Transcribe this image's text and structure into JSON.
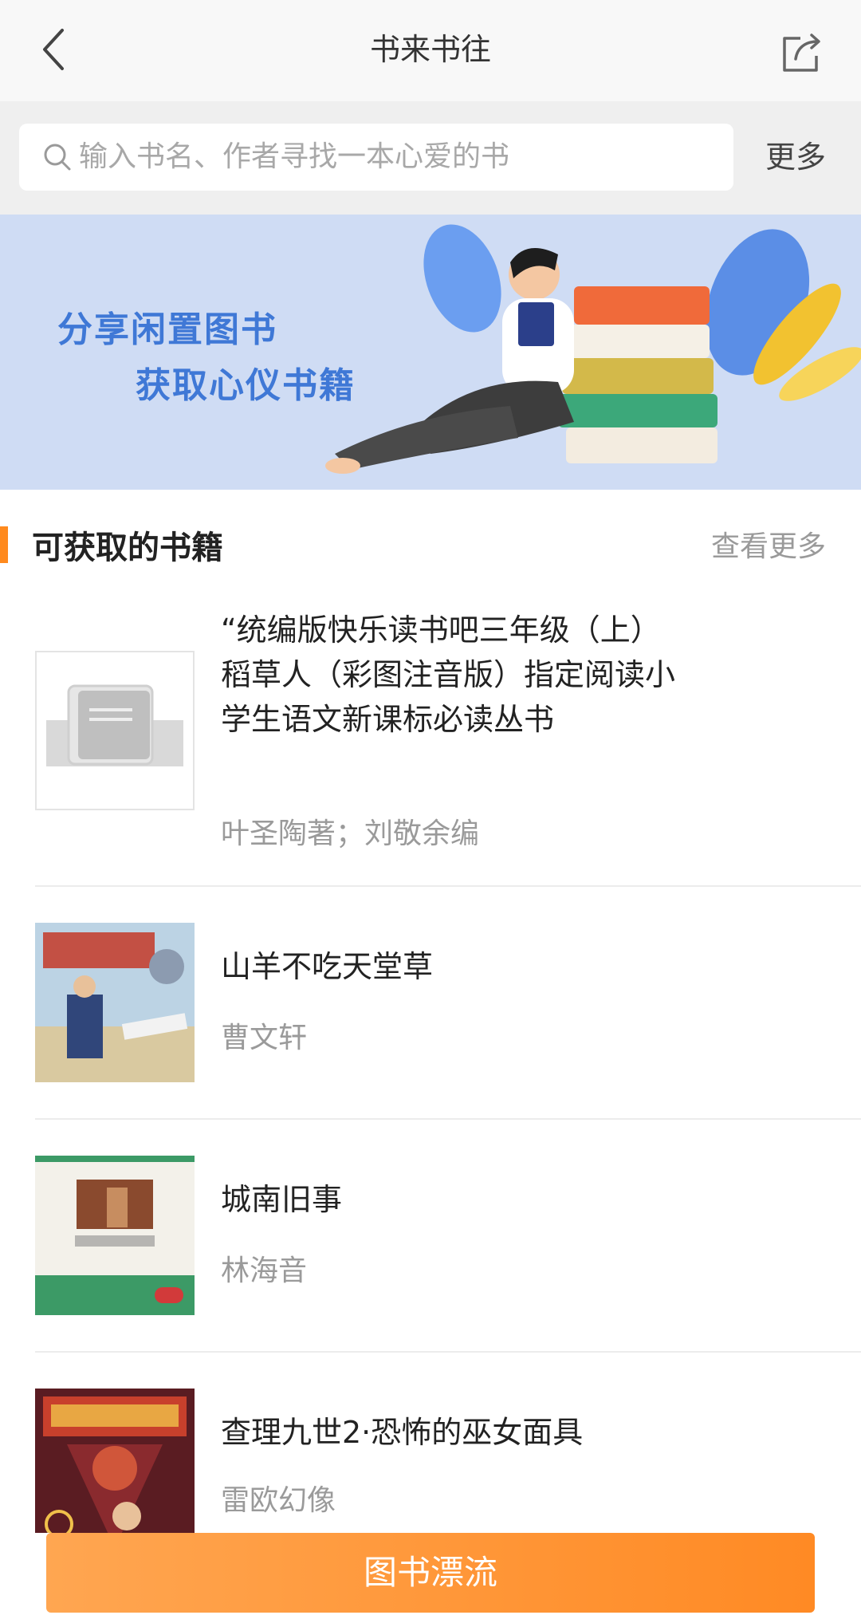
{
  "header": {
    "title": "书来书往"
  },
  "search": {
    "placeholder": "输入书名、作者寻找一本心爱的书",
    "more_label": "更多"
  },
  "banner": {
    "line1": "分享闲置图书",
    "line2": "获取心仪书籍"
  },
  "section": {
    "title": "可获取的书籍",
    "view_more": "查看更多"
  },
  "books": [
    {
      "title": "“统编版快乐读书吧三年级（上）稻草人（彩图注音版）指定阅读小学生语文新课标必读丛书",
      "author": "叶圣陶著；刘敬余编",
      "cover": "placeholder-book-icon"
    },
    {
      "title": "山羊不吃天堂草",
      "author": "曹文轩",
      "cover": "book-cover-image"
    },
    {
      "title": "城南旧事",
      "author": "林海音",
      "cover": "book-cover-image"
    },
    {
      "title": "查理九世2·恐怖的巫女面具",
      "author": "雷欧幻像",
      "cover": "book-cover-image"
    }
  ],
  "bottom_button": {
    "label": "图书漂流"
  },
  "colors": {
    "accent": "#ff8a1e",
    "banner_text": "#3f78d6",
    "muted": "#9a9a9a"
  }
}
